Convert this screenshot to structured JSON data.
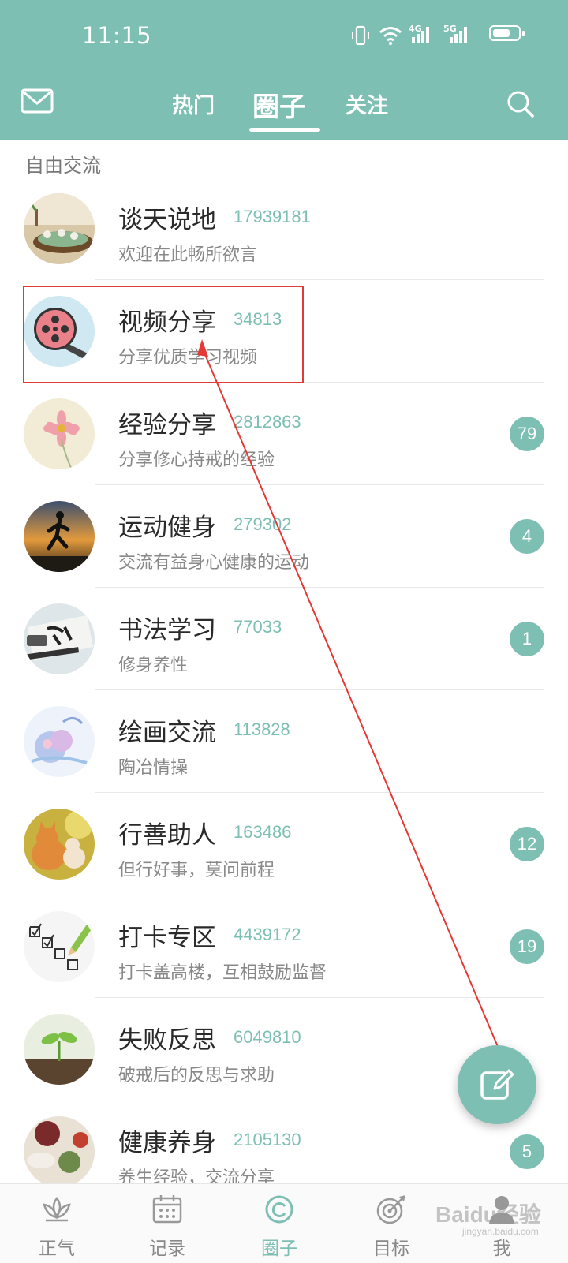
{
  "status_bar": {
    "time": "11:15",
    "net1": "4G",
    "net2": "5G",
    "battery_level": 0.7
  },
  "header": {
    "tabs": [
      {
        "label": "热门"
      },
      {
        "label": "圈子"
      },
      {
        "label": "关注"
      }
    ],
    "active_tab": "圈子",
    "icons": {
      "left": "mail-icon",
      "right": "search-icon"
    }
  },
  "section": {
    "title": "自由交流"
  },
  "circles": [
    {
      "name": "谈天说地",
      "members": "17939181",
      "desc": "欢迎在此畅所欲言",
      "badge": "",
      "icon": "tea-table-photo"
    },
    {
      "name": "视频分享",
      "members": "34813",
      "desc": "分享优质学习视频",
      "badge": "",
      "icon": "film-reel-photo"
    },
    {
      "name": "经验分享",
      "members": "2812863",
      "desc": "分享修心持戒的经验",
      "badge": "79",
      "icon": "flower-photo"
    },
    {
      "name": "运动健身",
      "members": "279302",
      "desc": "交流有益身心健康的运动",
      "badge": "4",
      "icon": "runner-sunset-photo"
    },
    {
      "name": "书法学习",
      "members": "77033",
      "desc": "修身养性",
      "badge": "1",
      "icon": "calligraphy-photo"
    },
    {
      "name": "绘画交流",
      "members": "113828",
      "desc": "陶冶情操",
      "badge": "",
      "icon": "painting-photo"
    },
    {
      "name": "行善助人",
      "members": "163486",
      "desc": "但行好事，莫问前程",
      "badge": "12",
      "icon": "cats-photo"
    },
    {
      "name": "打卡专区",
      "members": "4439172",
      "desc": "打卡盖高楼，互相鼓励监督",
      "badge": "19",
      "icon": "checklist-photo"
    },
    {
      "name": "失败反思",
      "members": "6049810",
      "desc": "破戒后的反思与求助",
      "badge": "",
      "icon": "sprout-photo"
    },
    {
      "name": "健康养身",
      "members": "2105130",
      "desc": "养生经验，交流分享",
      "badge": "5",
      "icon": "herbs-photo"
    }
  ],
  "fab": {
    "icon": "edit-icon"
  },
  "bottom_nav": [
    {
      "label": "正气",
      "icon": "lotus-icon"
    },
    {
      "label": "记录",
      "icon": "calendar-icon"
    },
    {
      "label": "圈子",
      "icon": "circle-icon"
    },
    {
      "label": "目标",
      "icon": "target-icon"
    },
    {
      "label": "我",
      "icon": "person-icon"
    }
  ],
  "active_nav": "圈子",
  "watermark": {
    "brand": "Baidu经验",
    "site": "jingyan.baidu.com"
  },
  "colors": {
    "primary": "#7dbfb3",
    "annotation": "#e53935",
    "badge_text": "#ffffff"
  }
}
